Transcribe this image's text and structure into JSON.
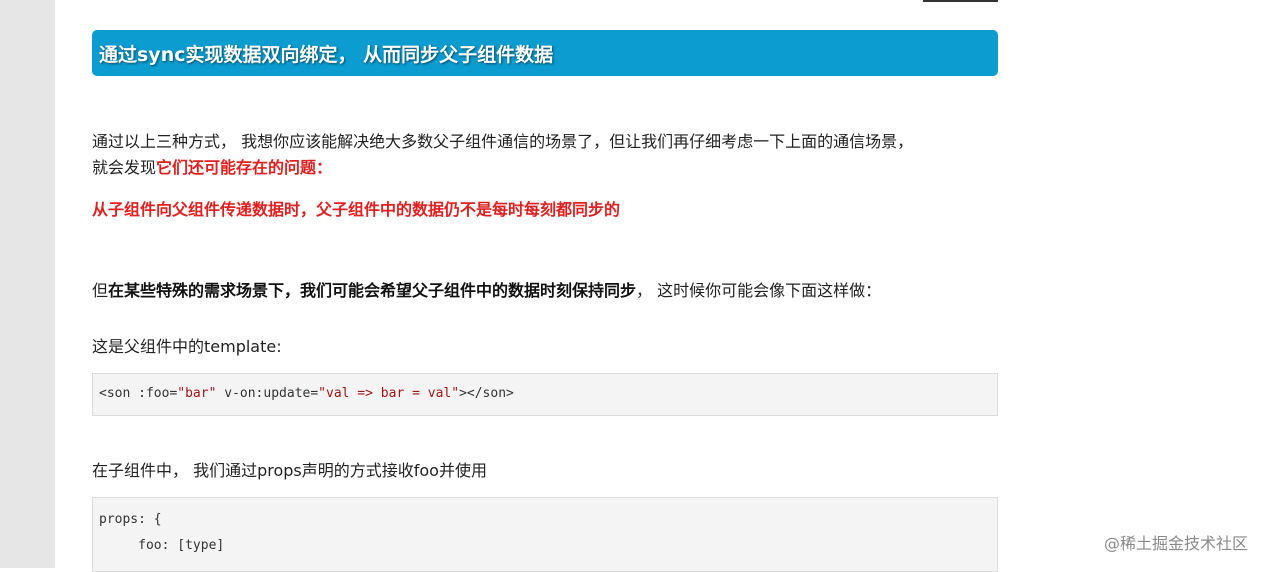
{
  "heading": "通过sync实现数据双向绑定， 从而同步父子组件数据",
  "intro": {
    "line1": "通过以上三种方式， 我想你应该能解决绝大多数父子组件通信的场景了，但让我们再仔细考虑一下上面的通信场景，",
    "line2_prefix": "就会发现",
    "line2_red": "它们还可能存在的问题："
  },
  "problem": "从子组件向父组件传递数据时，父子组件中的数据仍不是每时每刻都同步的",
  "special": {
    "prefix": "但",
    "bold": "在某些特殊的需求场景下，我们可能会希望父子组件中的数据时刻保持同步",
    "suffix": "， 这时候你可能会像下面这样做："
  },
  "template_label": "这是父组件中的template:",
  "code1": {
    "p1": "<son :foo=",
    "s1": "\"bar\"",
    "p2": " v-on:update=",
    "s2": "\"val => bar = val\"",
    "p3": "></son>"
  },
  "child_label": "在子组件中， 我们通过props声明的方式接收foo并使用",
  "code2": {
    "line1": "props: {",
    "line2": "     foo: [type]"
  },
  "watermark": "@稀土掘金技术社区"
}
